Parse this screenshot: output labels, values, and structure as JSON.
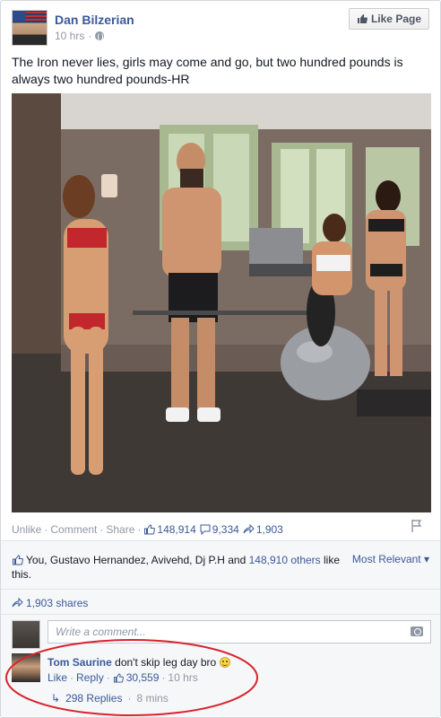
{
  "post": {
    "author": "Dan Bilzerian",
    "time": "10 hrs",
    "like_page_label": "Like Page",
    "message": "The Iron never lies, girls may come and go, but two hundred pounds is always two hundred pounds-HR"
  },
  "actions": {
    "unlike": "Unlike",
    "comment": "Comment",
    "share": "Share",
    "likes_count": "148,914",
    "comments_count": "9,334",
    "shares_count": "1,903"
  },
  "likes_summary": {
    "prefix": "You, Gustavo Hernandez, Avivehd, Dj P.H and ",
    "others": "148,910 others",
    "suffix": " like this."
  },
  "sort_label": "Most Relevant",
  "shares_label": "1,903 shares",
  "composer": {
    "placeholder": "Write a comment..."
  },
  "comment": {
    "author": "Tom Saurine",
    "text": "don't skip leg day bro",
    "like": "Like",
    "reply": "Reply",
    "likes_count": "30,559",
    "time": "10 hrs",
    "replies_label": "298 Replies",
    "replies_time": "8 mins"
  },
  "colors": {
    "link": "#3b5998",
    "muted": "#9197a3",
    "annotation": "#d9232c"
  }
}
